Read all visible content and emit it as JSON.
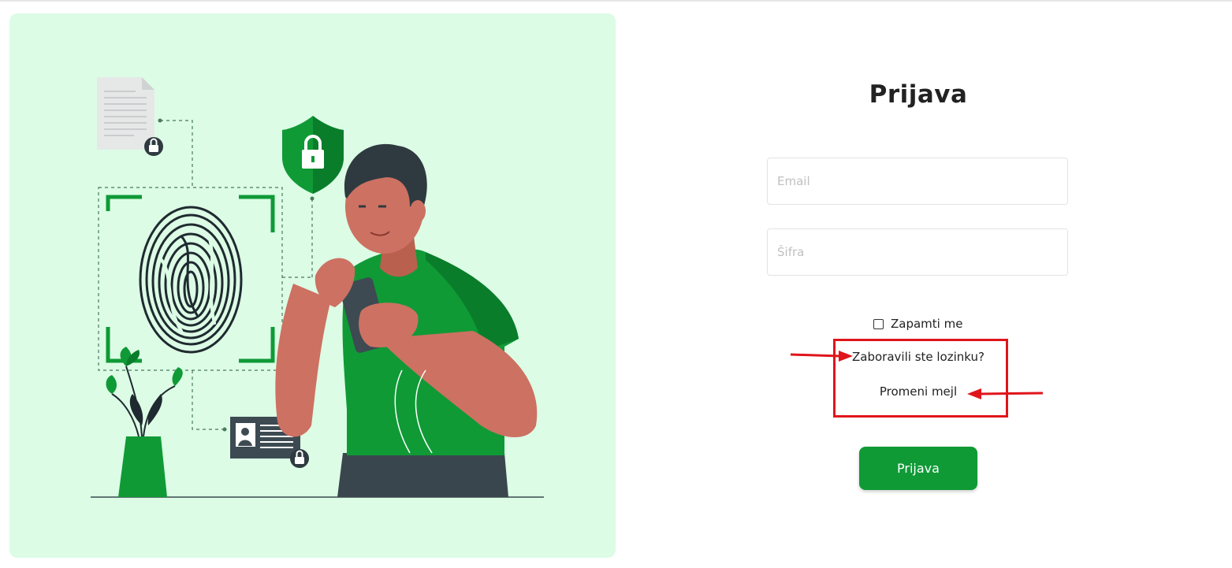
{
  "login": {
    "title": "Prijava",
    "email_placeholder": "Email",
    "password_placeholder": "Šifra",
    "remember_label": "Zapamti me",
    "forgot_link": "Zaboravili ste lozinku?",
    "change_email_link": "Promeni mejl",
    "submit_label": "Prijava"
  },
  "colors": {
    "panel_bg": "#dcfce5",
    "brand_green": "#0f9a36",
    "annotation_red": "#e0151b"
  },
  "illustration": {
    "icons": [
      "document-icon",
      "shield-lock-icon",
      "fingerprint-icon",
      "id-card-icon",
      "padlock-icon",
      "plant-icon",
      "person-with-phone"
    ]
  }
}
